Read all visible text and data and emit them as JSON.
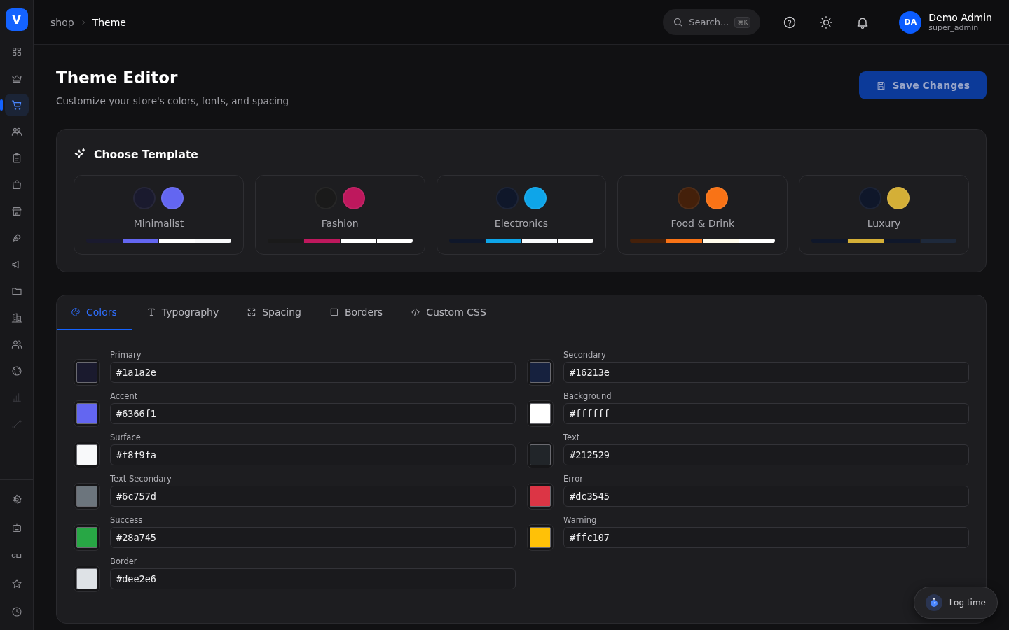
{
  "sidebar": {
    "logo": "V",
    "items": [
      {
        "kind": "icon",
        "selected": false,
        "disabled": false
      },
      {
        "kind": "icon",
        "selected": false,
        "disabled": false
      },
      {
        "kind": "icon",
        "selected": true,
        "disabled": false
      },
      {
        "kind": "icon",
        "selected": false,
        "disabled": false
      },
      {
        "kind": "icon",
        "selected": false,
        "disabled": false
      },
      {
        "kind": "icon",
        "selected": false,
        "disabled": false
      },
      {
        "kind": "icon",
        "selected": false,
        "disabled": false
      },
      {
        "kind": "icon",
        "selected": false,
        "disabled": false
      },
      {
        "kind": "icon",
        "selected": false,
        "disabled": false
      },
      {
        "kind": "icon",
        "selected": false,
        "disabled": false
      },
      {
        "kind": "icon",
        "selected": false,
        "disabled": false
      },
      {
        "kind": "icon",
        "selected": false,
        "disabled": false
      },
      {
        "kind": "icon",
        "selected": false,
        "disabled": false
      },
      {
        "kind": "icon",
        "selected": false,
        "disabled": true
      },
      {
        "kind": "icon",
        "selected": false,
        "disabled": true
      }
    ],
    "bottom_items": [
      {
        "kind": "icon",
        "selected": false
      },
      {
        "kind": "icon",
        "selected": false
      },
      {
        "kind": "text",
        "label": "CLI",
        "selected": false
      },
      {
        "kind": "icon",
        "selected": false
      },
      {
        "kind": "icon",
        "selected": false
      }
    ]
  },
  "breadcrumb": [
    "shop",
    "Theme"
  ],
  "search": {
    "placeholder": "Search...",
    "shortcut": "⌘K"
  },
  "user": {
    "initials": "DA",
    "name": "Demo Admin",
    "role": "super_admin"
  },
  "page": {
    "title": "Theme Editor",
    "subtitle": "Customize your store's colors, fonts, and spacing",
    "save_button": "Save Changes"
  },
  "templates": {
    "title": "Choose Template",
    "items": [
      {
        "name": "Minimalist",
        "circles": [
          {
            "color": "#1a1a2e"
          },
          {
            "color": "#6366f1"
          }
        ],
        "stripes": [
          {
            "color": "#1a1a2e"
          },
          {
            "color": "#6366f1"
          },
          {
            "color": "#ffffff"
          },
          {
            "color": "#f8f9fa"
          }
        ]
      },
      {
        "name": "Fashion",
        "circles": [
          {
            "color": "#1a1a1a"
          },
          {
            "color": "#be185d"
          }
        ],
        "stripes": [
          {
            "color": "#1a1a1a"
          },
          {
            "color": "#be185d"
          },
          {
            "color": "#ffffff"
          },
          {
            "color": "#ffffff"
          }
        ]
      },
      {
        "name": "Electronics",
        "circles": [
          {
            "color": "#0f172a"
          },
          {
            "color": "#0ea5e9"
          }
        ],
        "stripes": [
          {
            "color": "#0f172a"
          },
          {
            "color": "#0ea5e9"
          },
          {
            "color": "#f8fafc"
          },
          {
            "color": "#ffffff"
          }
        ]
      },
      {
        "name": "Food & Drink",
        "circles": [
          {
            "color": "#44200a"
          },
          {
            "color": "#f97316"
          }
        ],
        "stripes": [
          {
            "color": "#44200a"
          },
          {
            "color": "#f97316"
          },
          {
            "color": "#fffbeb"
          },
          {
            "color": "#ffffff"
          }
        ]
      },
      {
        "name": "Luxury",
        "circles": [
          {
            "color": "#0f172a"
          },
          {
            "color": "#d4af37"
          }
        ],
        "stripes": [
          {
            "color": "#0f172a"
          },
          {
            "color": "#d4af37"
          },
          {
            "color": "#0f172a"
          },
          {
            "color": "#1e293b"
          }
        ]
      }
    ]
  },
  "tabs": [
    {
      "label": "Colors",
      "selected": true
    },
    {
      "label": "Typography",
      "selected": false
    },
    {
      "label": "Spacing",
      "selected": false
    },
    {
      "label": "Borders",
      "selected": false
    },
    {
      "label": "Custom CSS",
      "selected": false
    }
  ],
  "colors": [
    {
      "label": "Primary",
      "value": "#1a1a2e",
      "color": "#1a1a2e"
    },
    {
      "label": "Secondary",
      "value": "#16213e",
      "color": "#16213e"
    },
    {
      "label": "Accent",
      "value": "#6366f1",
      "color": "#6366f1"
    },
    {
      "label": "Background",
      "value": "#ffffff",
      "color": "#ffffff"
    },
    {
      "label": "Surface",
      "value": "#f8f9fa",
      "color": "#f8f9fa"
    },
    {
      "label": "Text",
      "value": "#212529",
      "color": "#212529"
    },
    {
      "label": "Text Secondary",
      "value": "#6c757d",
      "color": "#6c757d"
    },
    {
      "label": "Error",
      "value": "#dc3545",
      "color": "#dc3545"
    },
    {
      "label": "Success",
      "value": "#28a745",
      "color": "#28a745"
    },
    {
      "label": "Warning",
      "value": "#ffc107",
      "color": "#ffc107"
    },
    {
      "label": "Border",
      "value": "#dee2e6",
      "color": "#dee2e6"
    }
  ],
  "log_time": {
    "label": "Log time"
  }
}
